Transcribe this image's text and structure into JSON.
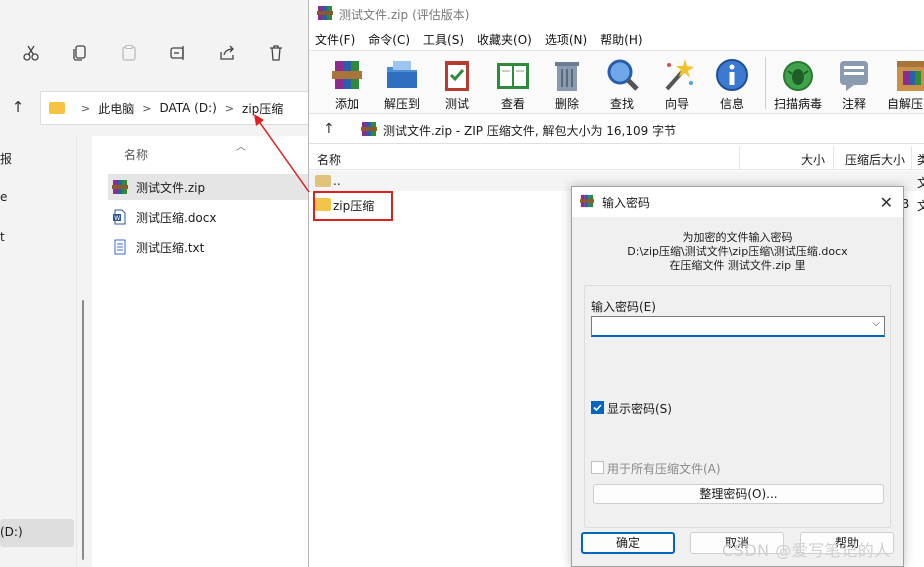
{
  "explorer": {
    "address": {
      "segments": [
        "此电脑",
        "DATA (D:)",
        "zip压缩"
      ]
    },
    "nav": {
      "items": [
        "报",
        "e",
        "t",
        "(D:)"
      ]
    },
    "list": {
      "header_name": "名称",
      "files": [
        {
          "name": "测试文件.zip",
          "type": "zip",
          "selected": true
        },
        {
          "name": "测试压缩.docx",
          "type": "docx",
          "selected": false
        },
        {
          "name": "测试压缩.txt",
          "type": "txt",
          "selected": false
        }
      ]
    }
  },
  "winrar": {
    "title": "测试文件.zip",
    "title_suffix": "(评估版本)",
    "menu": [
      "文件(F)",
      "命令(C)",
      "工具(S)",
      "收藏夹(O)",
      "选项(N)",
      "帮助(H)"
    ],
    "tools": [
      "添加",
      "解压到",
      "测试",
      "查看",
      "删除",
      "查找",
      "向导",
      "信息",
      "扫描病毒",
      "注释",
      "自解压"
    ],
    "path_text": "测试文件.zip - ZIP 压缩文件, 解包大小为 16,109 字节",
    "columns": {
      "name": "名称",
      "size": "大小",
      "packed": "压缩后大小",
      "type": "类"
    },
    "rows": [
      {
        "name": "..",
        "type_cell": "文"
      },
      {
        "name": "zip压缩",
        "type_cell": "文",
        "extra": "B"
      }
    ]
  },
  "dialog": {
    "title": "输入密码",
    "message_line1": "为加密的文件输入密码",
    "message_line2": "D:\\zip压缩\\测试文件\\zip压缩\\测试压缩.docx",
    "message_line3": "在压缩文件 测试文件.zip 里",
    "password_label": "输入密码(E)",
    "password_value": "",
    "show_password_label": "显示密码(S)",
    "show_password_checked": true,
    "use_all_label": "用于所有压缩文件(A)",
    "use_all_checked": false,
    "organize_label": "整理密码(O)...",
    "ok_label": "确定",
    "cancel_label": "取消",
    "help_label": "帮助"
  },
  "watermark": "CSDN @爱写笔记的人"
}
